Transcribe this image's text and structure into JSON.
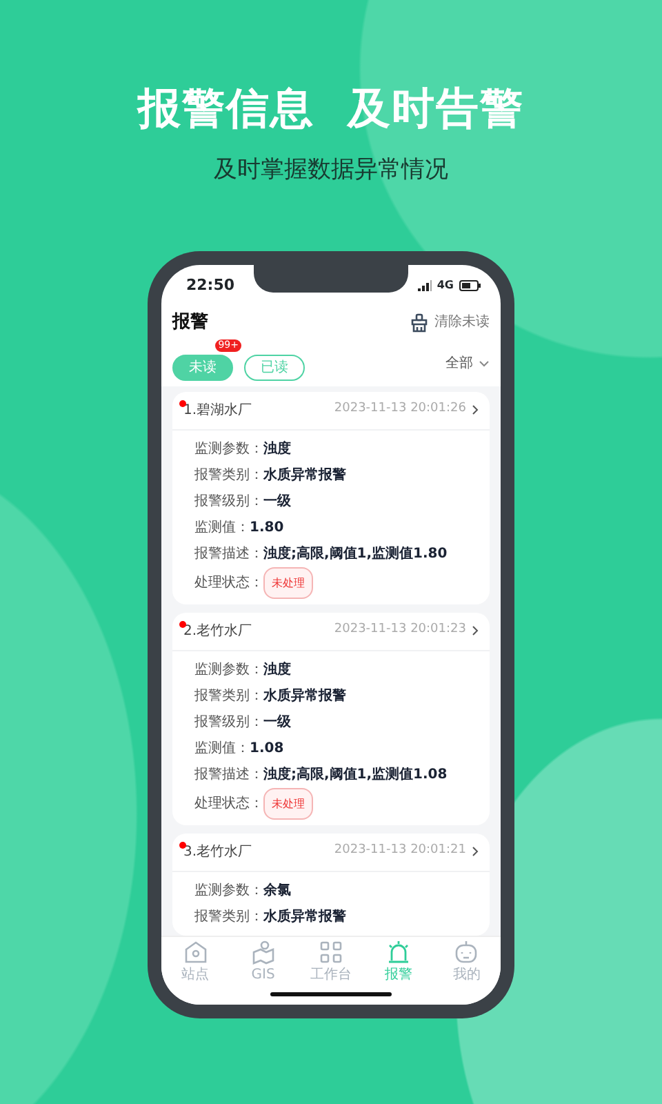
{
  "headline": "报警信息  及时告警",
  "subheadline": "及时掌握数据异常情况",
  "phone": {
    "status_bar": {
      "time": "22:50",
      "network": "4G"
    },
    "header": {
      "title": "报警",
      "clear_button": "清除未读"
    },
    "tabs": [
      {
        "label": "未读",
        "selected": true,
        "badge": "99+"
      },
      {
        "label": "已读",
        "selected": false
      }
    ],
    "filter": "全部",
    "alerts": [
      {
        "title": "1.碧湖水厂",
        "unread": true,
        "time": "2023-11-13 20:01:26",
        "fields": [
          {
            "label": "监测参数：",
            "value": "浊度"
          },
          {
            "label": "报警类别：",
            "value": "水质异常报警"
          },
          {
            "label": "报警级别：",
            "value": "一级"
          },
          {
            "label": "监测值：",
            "value": "1.80"
          },
          {
            "label": "报警描述：",
            "value": "浊度;高限,阈值1,监测值1.80"
          }
        ],
        "status_label": "处理状态：",
        "status": "未处理"
      },
      {
        "title": "2.老竹水厂",
        "unread": true,
        "time": "2023-11-13 20:01:23",
        "fields": [
          {
            "label": "监测参数：",
            "value": "浊度"
          },
          {
            "label": "报警类别：",
            "value": "水质异常报警"
          },
          {
            "label": "报警级别：",
            "value": "一级"
          },
          {
            "label": "监测值：",
            "value": "1.08"
          },
          {
            "label": "报警描述：",
            "value": "浊度;高限,阈值1,监测值1.08"
          }
        ],
        "status_label": "处理状态：",
        "status": "未处理"
      },
      {
        "title": "3.老竹水厂",
        "unread": true,
        "time": "2023-11-13 20:01:21",
        "fields": [
          {
            "label": "监测参数：",
            "value": "余氯"
          },
          {
            "label": "报警类别：",
            "value": "水质异常报警"
          }
        ]
      }
    ],
    "nav": [
      {
        "label": "站点",
        "kind": "home",
        "selected": false
      },
      {
        "label": "GIS",
        "kind": "map",
        "selected": false
      },
      {
        "label": "工作台",
        "kind": "grid",
        "selected": false
      },
      {
        "label": "报警",
        "kind": "alarm",
        "selected": true
      },
      {
        "label": "我的",
        "kind": "robot",
        "selected": false
      }
    ]
  }
}
